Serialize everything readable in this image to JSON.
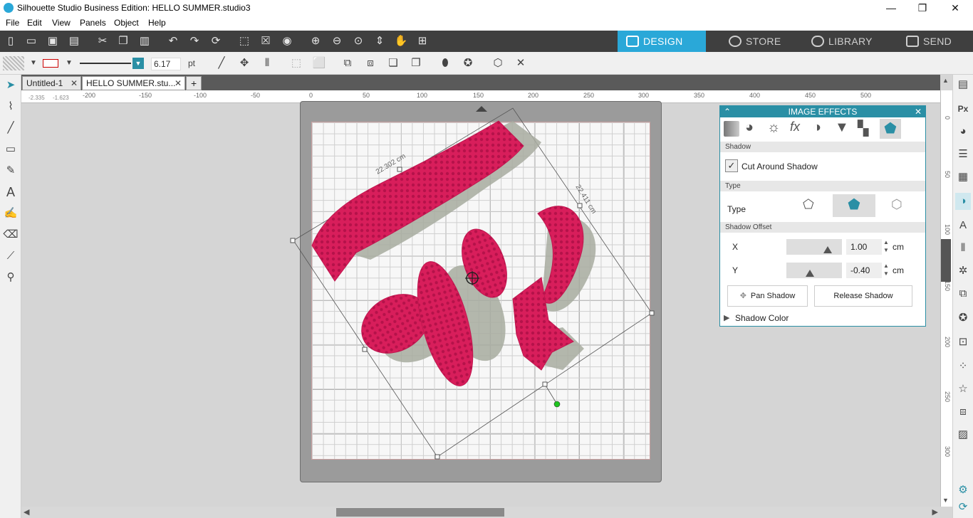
{
  "window": {
    "title": "Silhouette Studio Business Edition: HELLO SUMMER.studio3",
    "minimize": "—",
    "maximize": "❐",
    "close": "✕"
  },
  "menu": [
    "File",
    "Edit",
    "View",
    "Panels",
    "Object",
    "Help"
  ],
  "mode_tabs": {
    "design": "DESIGN",
    "store": "STORE",
    "library": "LIBRARY",
    "send": "SEND"
  },
  "line_style": {
    "width_value": "6.17",
    "unit": "pt"
  },
  "doc_tabs": [
    {
      "label": "Untitled-1"
    },
    {
      "label": "HELLO SUMMER.stu..."
    }
  ],
  "new_tab": "+",
  "coordinates": {
    "x": "-2.335",
    "y": "-1.623"
  },
  "ruler_h": [
    "-200",
    "-150",
    "-100",
    "-50",
    "0",
    "50",
    "100",
    "150",
    "200",
    "250",
    "300",
    "350",
    "400",
    "450",
    "500"
  ],
  "ruler_v": [
    "0",
    "50",
    "100",
    "150",
    "200",
    "250",
    "300"
  ],
  "selection": {
    "width_label": "22.302 cm",
    "height_label": "22.411 cm"
  },
  "panel": {
    "title": "IMAGE EFFECTS",
    "section_shadow": "Shadow",
    "cut_around_shadow": "Cut Around Shadow",
    "section_type": "Type",
    "type_label": "Type",
    "section_offset": "Shadow Offset",
    "x_label": "X",
    "x_value": "1.00",
    "y_label": "Y",
    "y_value": "-0.40",
    "unit": "cm",
    "pan_shadow": "Pan Shadow",
    "release_shadow": "Release Shadow",
    "shadow_color": "Shadow Color"
  },
  "colors": {
    "accent": "#2a8fa5",
    "design_pink": "#d81e5b",
    "shadow_gray": "#a8aca0"
  }
}
